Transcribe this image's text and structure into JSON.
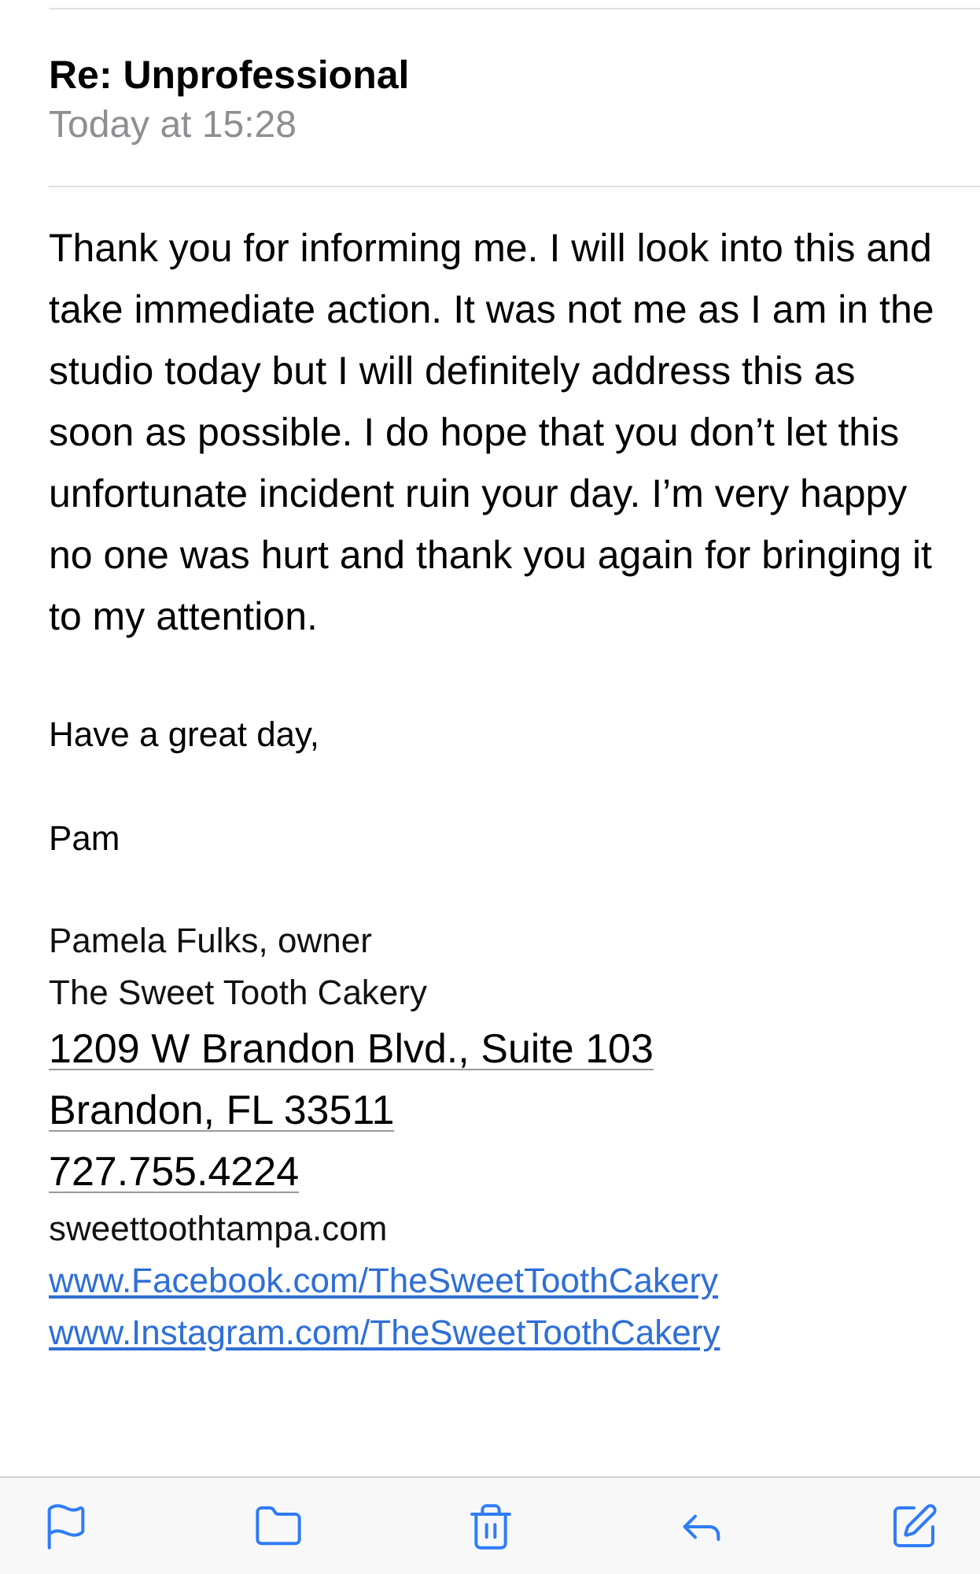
{
  "email": {
    "subject": "Re: Unprofessional",
    "date": "Today at 15:28",
    "body": "Thank you for informing me. I will look into this and take immediate action. It was not me as I am in the studio today but I will definitely address this as soon as possible. I do hope that you don’t let this unfortunate incident ruin your day. I’m very happy no one was hurt and thank you again for bringing it to my attention.",
    "closing": "Have a great day,",
    "name": "Pam",
    "signature": [
      {
        "kind": "plain",
        "text": "Pamela Fulks, owner"
      },
      {
        "kind": "plain",
        "text": "The Sweet Tooth Cakery"
      },
      {
        "kind": "detected",
        "text": "1209 W Brandon Blvd., Suite 103"
      },
      {
        "kind": "detected",
        "text": "Brandon, FL 33511"
      },
      {
        "kind": "detected",
        "text": "727.755.4224"
      },
      {
        "kind": "plain",
        "text": "sweettoothtampa.com"
      },
      {
        "kind": "link",
        "text": "www.Facebook.com/TheSweetToothCakery"
      },
      {
        "kind": "link",
        "text": "www.Instagram.com/TheSweetToothCakery"
      }
    ]
  }
}
